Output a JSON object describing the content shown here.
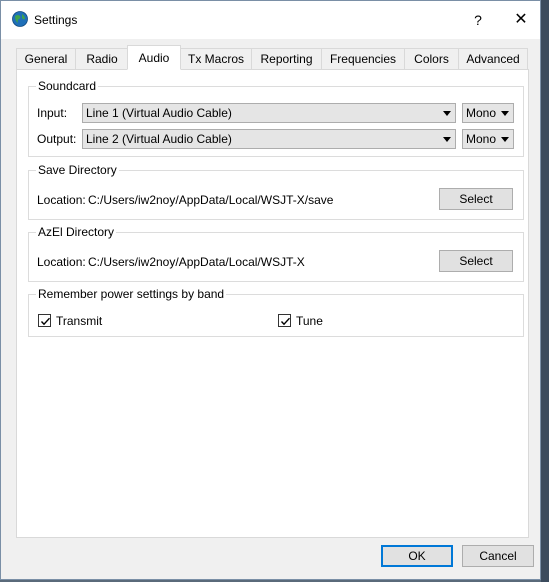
{
  "window": {
    "title": "Settings",
    "help_glyph": "?",
    "close_glyph": "✕"
  },
  "tabs": [
    {
      "label": "General"
    },
    {
      "label": "Radio"
    },
    {
      "label": "Audio",
      "active": true
    },
    {
      "label": "Tx Macros"
    },
    {
      "label": "Reporting"
    },
    {
      "label": "Frequencies"
    },
    {
      "label": "Colors"
    },
    {
      "label": "Advanced"
    }
  ],
  "soundcard": {
    "title": "Soundcard",
    "input_label": "Input:",
    "input_value": "Line 1 (Virtual Audio Cable)",
    "input_channel": "Mono",
    "output_label": "Output:",
    "output_value": "Line 2 (Virtual Audio Cable)",
    "output_channel": "Mono"
  },
  "save_directory": {
    "title": "Save Directory",
    "location_label": "Location:",
    "path": "C:/Users/iw2noy/AppData/Local/WSJT-X/save",
    "button": "Select"
  },
  "azel_directory": {
    "title": "AzEl Directory",
    "location_label": "Location:",
    "path": "C:/Users/iw2noy/AppData/Local/WSJT-X",
    "button": "Select"
  },
  "power": {
    "title": "Remember power settings by band",
    "transmit_label": "Transmit",
    "transmit_checked": true,
    "tune_label": "Tune",
    "tune_checked": true
  },
  "footer": {
    "ok": "OK",
    "cancel": "Cancel"
  },
  "colors": {
    "accent": "#0078d7",
    "tab_border": "#d9d9d9",
    "button_bg": "#e1e1e1"
  }
}
